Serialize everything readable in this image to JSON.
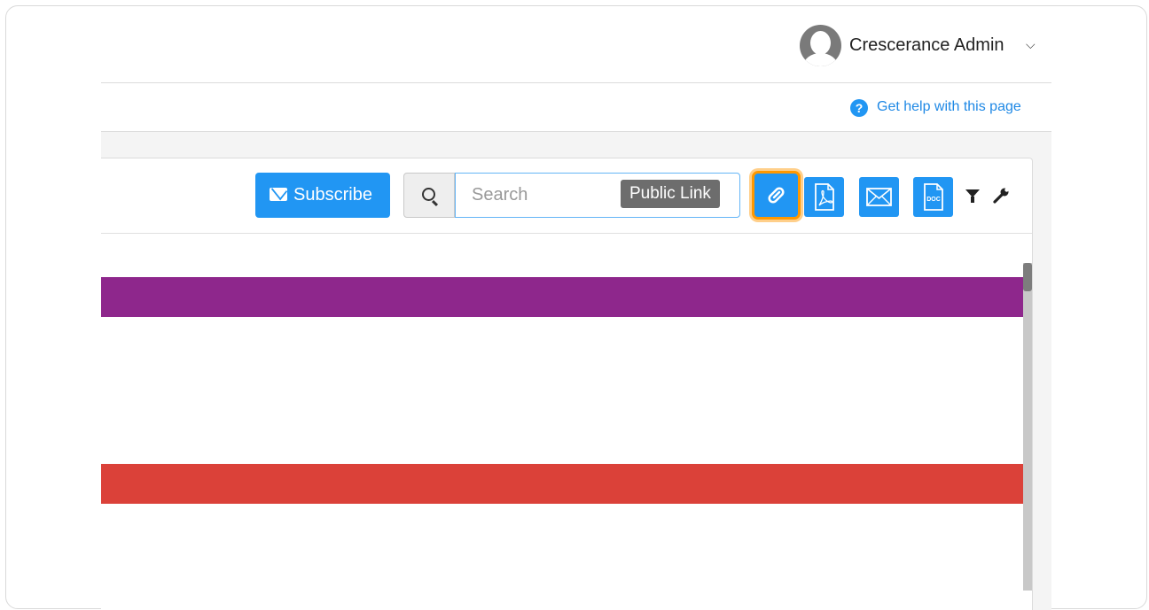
{
  "user": {
    "name": "Crescerance Admin",
    "menu_icon": "chevron-down-icon"
  },
  "help": {
    "label": "Get help with this page",
    "icon": "question-circle-icon"
  },
  "toolbar": {
    "subscribe_label": "Subscribe",
    "search_placeholder": "Search",
    "search_value": "",
    "tooltip": "Public Link",
    "buttons": [
      "link-icon",
      "pdf-icon",
      "email-icon",
      "doc-icon",
      "filter-icon",
      "wrench-icon"
    ],
    "doc_icon_text": "DOC"
  },
  "colors": {
    "accent": "#2196f3",
    "highlight": "#ff9800",
    "row_purple": "#8e278c",
    "row_red": "#db4139"
  }
}
